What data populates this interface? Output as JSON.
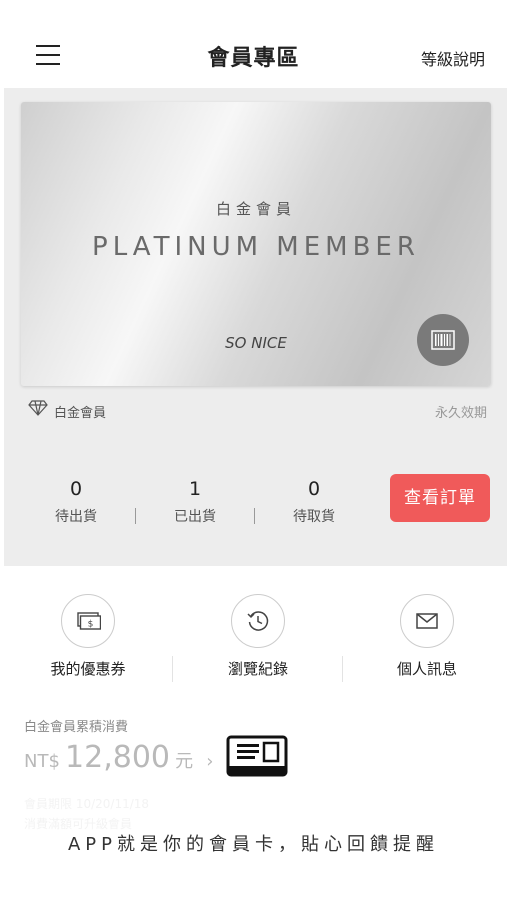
{
  "header": {
    "title": "會員專區",
    "level_link": "等級說明"
  },
  "card": {
    "title_cn": "白金會員",
    "title_en": "PLATINUM MEMBER",
    "brand": "SO NICE"
  },
  "tier": {
    "label": "白金會員",
    "validity": "永久效期"
  },
  "order_stats": [
    {
      "count": "0",
      "label": "待出貨"
    },
    {
      "count": "1",
      "label": "已出貨"
    },
    {
      "count": "0",
      "label": "待取貨"
    }
  ],
  "order_button": "查看訂單",
  "quick_links": [
    {
      "label": "我的優惠券",
      "icon": "coupon-icon"
    },
    {
      "label": "瀏覽紀錄",
      "icon": "history-icon"
    },
    {
      "label": "個人訊息",
      "icon": "mail-icon"
    }
  ],
  "spend": {
    "label": "白金會員累積消費",
    "currency": "NT$",
    "amount": "12,800",
    "unit": "元",
    "chevron": "›"
  },
  "faded": {
    "line1": "會員期限 10/20/11/18",
    "line2": "消費滿額可升級會員"
  },
  "banner_text": "APP就是你的會員卡，貼心回饋提醒",
  "colors": {
    "accent": "#f05a5a",
    "section_bg": "#ededed"
  }
}
